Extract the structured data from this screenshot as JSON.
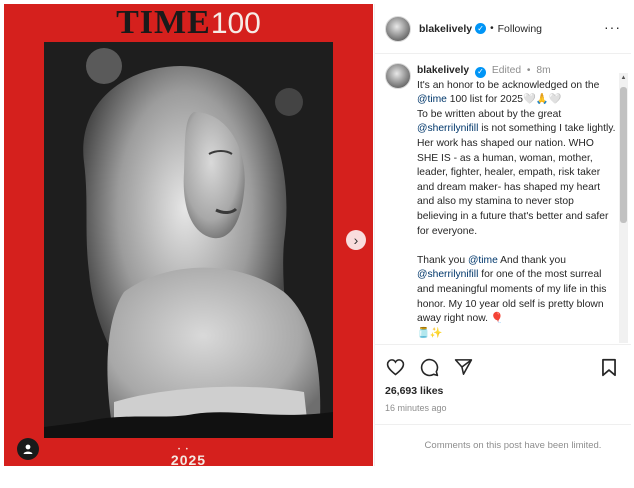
{
  "media": {
    "magazine_title": "TIME",
    "magazine_number": "100",
    "year": "2025",
    "carousel_dots": "• •"
  },
  "header": {
    "username": "blakelively",
    "separator": "•",
    "follow_status": "Following",
    "more": "···"
  },
  "caption": {
    "username": "blakelively",
    "edited": "Edited",
    "dot": "•",
    "time_ago": "8m",
    "line1a": "It's an honor to be acknowledged on the ",
    "mention_time": "@time",
    "line1b": " 100 list for 2025🤍🙏🤍",
    "line2a": "To be written about by the great ",
    "mention_sherrily": "@sherrilynifill",
    "line2b": " is not something I take lightly. Her work has shaped our nation. WHO SHE IS - as a human, woman, mother, leader, fighter, healer, empath, risk taker and dream maker- has shaped my heart and also my stamina to never stop believing in a future that's better and safer for everyone.",
    "para2a": "Thank you ",
    "para2_mention_time": "@time",
    "para2b": " And thank you ",
    "para2_mention_sherrily": "@sherrilynifill",
    "para2c": " for one of the most surreal and meaningful moments of my life in this honor. My 10 year old self is pretty blown away right now. 🎈",
    "trailing": "🫙✨"
  },
  "actions": {
    "likes": "26,693 likes",
    "posted": "16 minutes ago"
  },
  "footer": {
    "limited_text": "Comments on this post have been limited."
  },
  "colors": {
    "time_red": "#d5201d",
    "link": "#00376b",
    "verified_blue": "#0095f6",
    "muted": "#8e8e8e"
  },
  "icons": [
    "verified-icon",
    "heart-icon",
    "comment-icon",
    "share-icon",
    "bookmark-icon",
    "chevron-right-icon",
    "user-tag-icon"
  ]
}
